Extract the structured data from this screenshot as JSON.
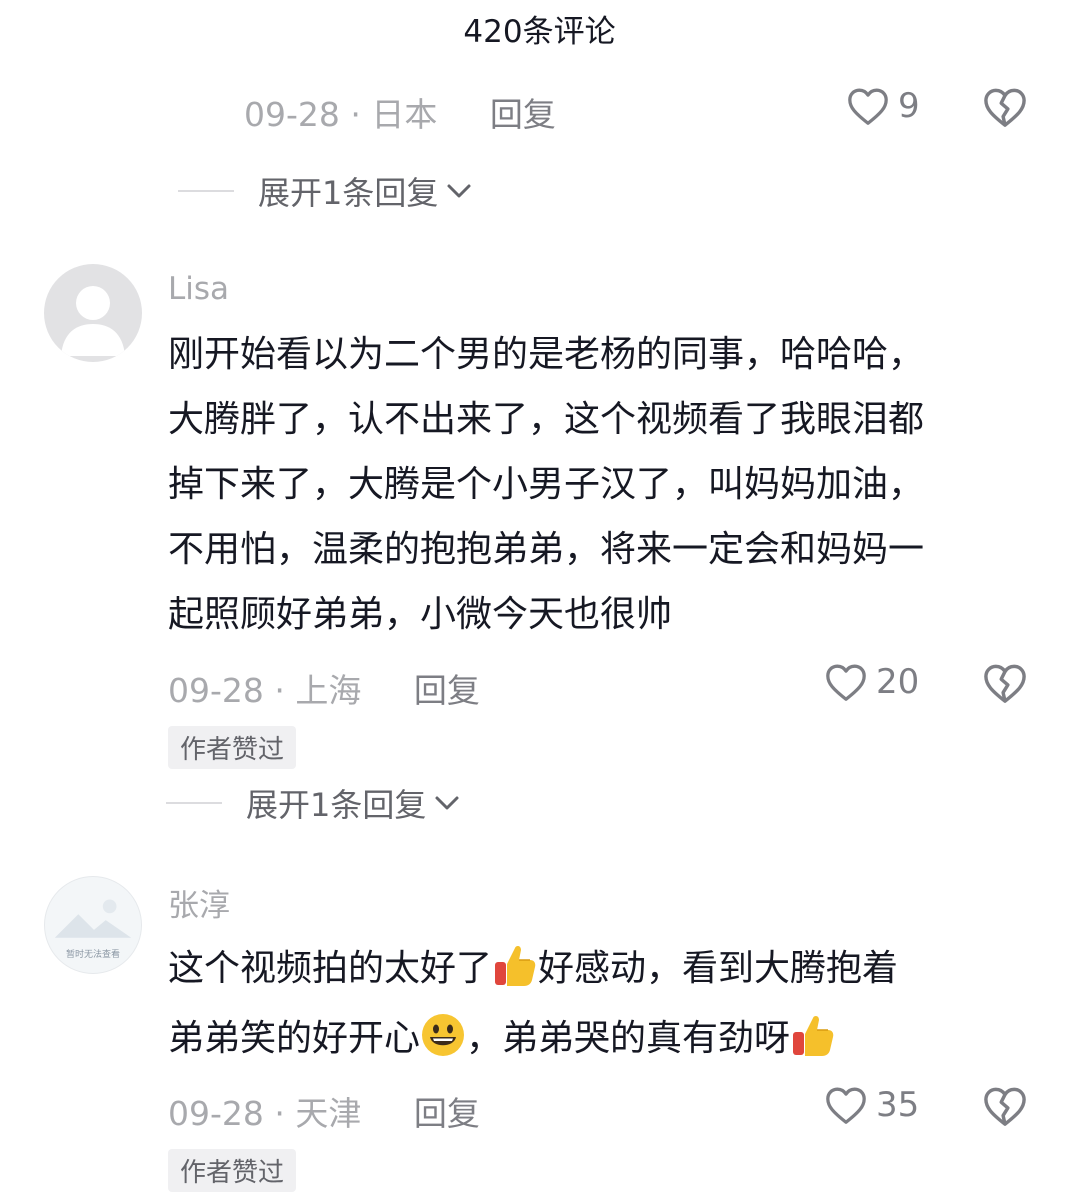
{
  "header": {
    "title": "420条评论"
  },
  "top_comment": {
    "date": "09-28",
    "location": "日本",
    "reply_label": "回复",
    "likes": "9",
    "expand_label": "展开1条回复"
  },
  "comments": [
    {
      "username": "Lisa",
      "content_lines": [
        "刚开始看以为二个男的是老杨的同事，哈哈哈，",
        "大腾胖了，认不出来了，这个视频看了我眼泪都",
        "掉下来了，大腾是个小男子汉了，叫妈妈加油，",
        "不用怕，温柔的抱抱弟弟，将来一定会和妈妈一",
        "起照顾好弟弟，小微今天也很帅"
      ],
      "date": "09-28",
      "location": "上海",
      "reply_label": "回复",
      "likes": "20",
      "badge": "作者赞过",
      "expand_label": "展开1条回复"
    },
    {
      "username": "张淳",
      "avatar_text": "暂时无法查看",
      "content_line1_a": "这个视频拍的太好了",
      "content_line1_b": "好感动，看到大腾抱着",
      "content_line2_a": "弟弟笑的好开心",
      "content_line2_b": "，弟弟哭的真有劲呀",
      "date": "09-28",
      "location": "天津",
      "reply_label": "回复",
      "likes": "35",
      "badge": "作者赞过"
    }
  ],
  "icons": {
    "like": "heart-outline-icon",
    "dislike": "broken-heart-icon",
    "expand": "chevron-down-icon",
    "emoji_thumbs": "thumbs-up-emoji",
    "emoji_grin": "grinning-face-emoji"
  },
  "colors": {
    "text": "#161823",
    "meta": "#a8a9ad",
    "secondary": "#63646a"
  }
}
